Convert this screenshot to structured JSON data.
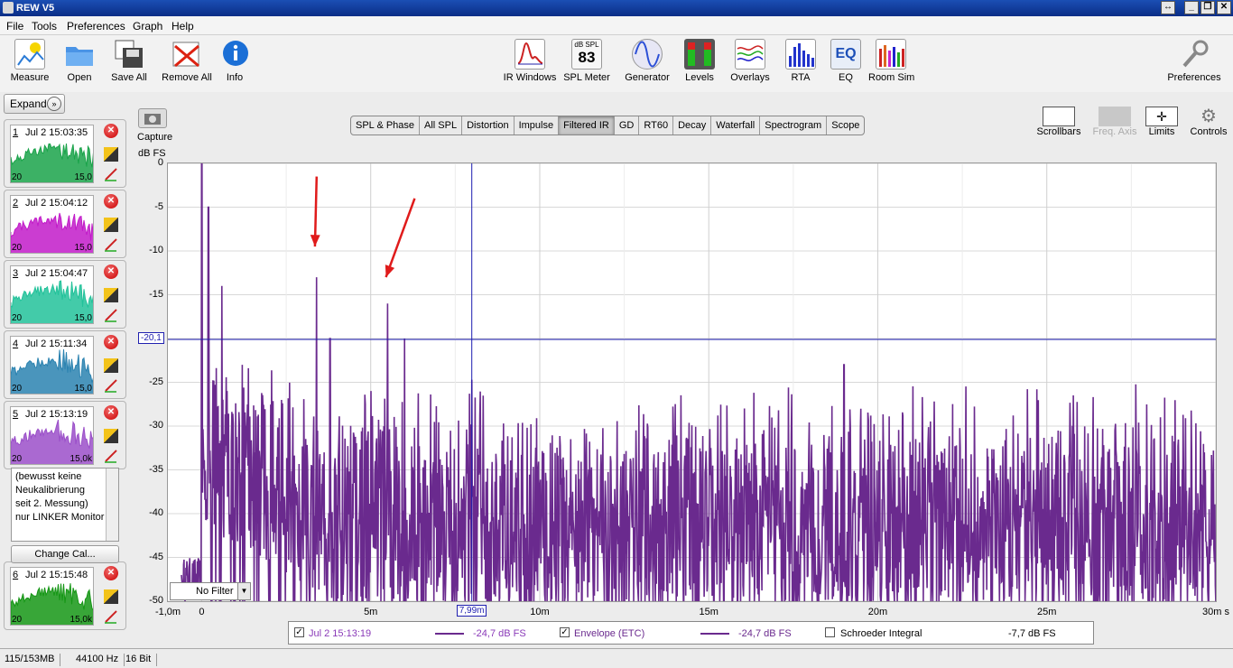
{
  "window": {
    "title": "REW V5",
    "min": "_",
    "max": "❐",
    "close": "✕",
    "restore": "↔"
  },
  "menu": [
    "File",
    "Tools",
    "Preferences",
    "Graph",
    "Help"
  ],
  "toolbar": {
    "left": [
      "Measure",
      "Open",
      "Save All",
      "Remove All",
      "Info"
    ],
    "center": [
      "IR Windows",
      "SPL Meter",
      "Generator",
      "Levels",
      "Overlays",
      "RTA",
      "EQ",
      "Room Sim"
    ],
    "spl_meter_unit": "dB SPL",
    "spl_meter_value": "83",
    "eq_icon_text": "EQ",
    "right": "Preferences"
  },
  "left_panel": {
    "expand_label": "Expand",
    "expand_icon": "»",
    "delete_glyph": "✕",
    "measurements": [
      {
        "num": "1",
        "title": "Jul 2 15:03:35",
        "color": "#1aa34a",
        "lo": "20",
        "hi": "15,0"
      },
      {
        "num": "2",
        "title": "Jul 2 15:04:12",
        "color": "#c21bc9",
        "lo": "20",
        "hi": "15,0"
      },
      {
        "num": "3",
        "title": "Jul 2 15:04:47",
        "color": "#22c29a",
        "lo": "20",
        "hi": "15,0"
      },
      {
        "num": "4",
        "title": "Jul 2 15:11:34",
        "color": "#2a82b0",
        "lo": "20",
        "hi": "15,0"
      },
      {
        "num": "5",
        "title": "Jul 2 15:13:19",
        "color": "#9b4fc9",
        "lo": "20",
        "hi": "15,0k"
      },
      {
        "num": "6",
        "title": "Jul 2 15:15:48",
        "color": "#159615",
        "lo": "20",
        "hi": "15,0k"
      }
    ],
    "notes": [
      "(bewusst keine",
      "Neukalibrierung",
      "seit 2. Messung)",
      "nur LINKER Monitor"
    ],
    "change_cal": "Change Cal..."
  },
  "graph": {
    "capture": "Capture",
    "tabs": [
      "SPL & Phase",
      "All SPL",
      "Distortion",
      "Impulse",
      "Filtered IR",
      "GD",
      "RT60",
      "Decay",
      "Waterfall",
      "Spectrogram",
      "Scope"
    ],
    "active_tab": "Filtered IR",
    "right_controls": [
      "Scrollbars",
      "Freq. Axis",
      "Limits",
      "Controls"
    ],
    "filter": "No Filter",
    "filter_arrow": "▼",
    "cursor_x": "7,99m",
    "cursor_y": "-20,1",
    "legend": {
      "m1_name": "Jul 2 15:13:19",
      "m1_value": "-24,7 dB FS",
      "m2_name": "Envelope (ETC)",
      "m2_value": "-24,7 dB FS",
      "m3_name": "Schroeder Integral",
      "m3_value": "-7,7 dB FS",
      "check": "✓"
    }
  },
  "chart_data": {
    "type": "line",
    "ylabel": "dB FS",
    "xlabel": "",
    "y_ticks": [
      "0",
      "-5",
      "-10",
      "-15",
      "-20",
      "-25",
      "-30",
      "-35",
      "-40",
      "-45",
      "-50"
    ],
    "x_ticks": [
      "-1,0m",
      "0",
      "5m",
      "10m",
      "15m",
      "20m",
      "25m",
      "30m s"
    ],
    "ylim": [
      -50,
      0
    ],
    "xlim": [
      -1,
      30
    ],
    "series_color": "#6a2a8e",
    "peaks": [
      {
        "x": 0.0,
        "y": 0
      },
      {
        "x": 0.2,
        "y": -5
      },
      {
        "x": 0.6,
        "y": -14
      },
      {
        "x": 1.2,
        "y": -23
      },
      {
        "x": 3.4,
        "y": -13
      },
      {
        "x": 3.8,
        "y": -20
      },
      {
        "x": 5.5,
        "y": -16
      },
      {
        "x": 6.0,
        "y": -20
      },
      {
        "x": 19.0,
        "y": -23
      },
      {
        "x": 7.99,
        "y": -24.7
      }
    ],
    "noise_floor": [
      -50,
      -25
    ],
    "cursor": {
      "x": 7.99,
      "y": -20.1
    },
    "grid": true
  },
  "status": {
    "memory": "115/153MB",
    "rate": "44100 Hz",
    "bits": "16 Bit"
  }
}
